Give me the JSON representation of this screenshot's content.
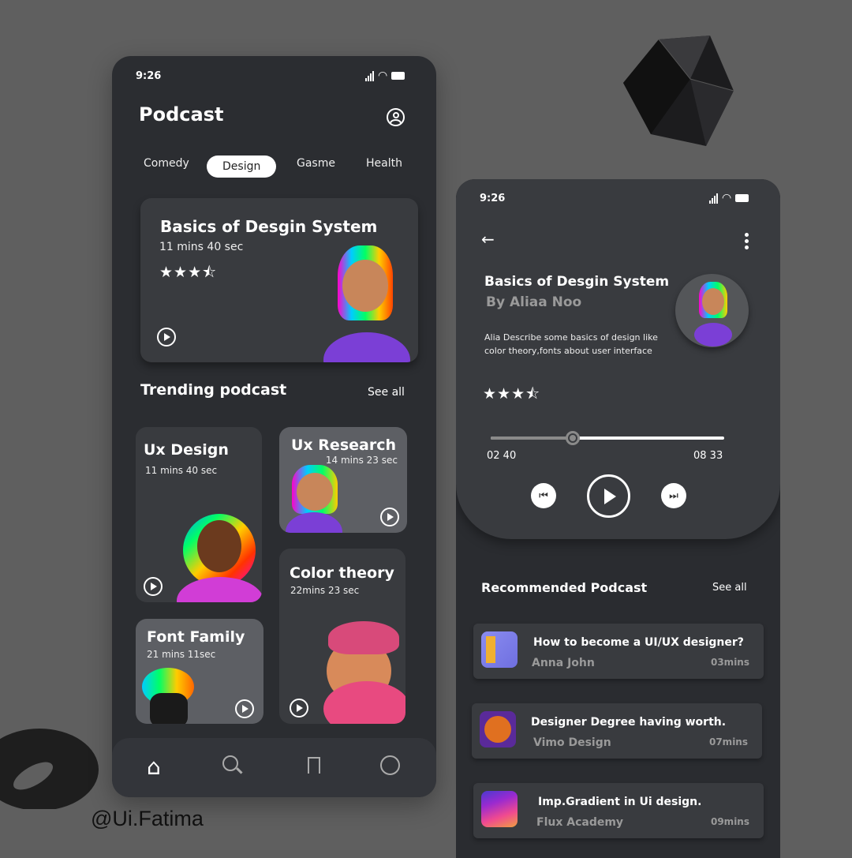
{
  "left_screen": {
    "status_time": "9:26",
    "title": "Podcast",
    "tabs": [
      {
        "label": "Comedy"
      },
      {
        "label": "Design",
        "active": true
      },
      {
        "label": "Gasme"
      },
      {
        "label": "Health"
      }
    ],
    "featured": {
      "title": "Basics of Desgin System",
      "duration": "11 mins 40 sec",
      "rating": 3.5,
      "stars": "★★★⯪"
    },
    "trending": {
      "title": "Trending podcast",
      "see_all": "See all",
      "items": [
        {
          "title": "Ux Design",
          "duration": "11 mins 40 sec"
        },
        {
          "title": "Ux Research",
          "duration": "14 mins 23 sec"
        },
        {
          "title": "Color theory",
          "duration": "22mins 23 sec"
        },
        {
          "title": "Font Family",
          "duration": "21 mins 11sec"
        }
      ]
    },
    "nav": [
      "home-icon",
      "search-icon",
      "bookmark-icon",
      "profile-icon"
    ]
  },
  "right_screen": {
    "status_time": "9:26",
    "title": "Basics of Desgin System",
    "author": "By  Aliaa Noo",
    "description_line1": "Alia Describe some basics of design like",
    "description_line2": "color theory,fonts  about user interface",
    "rating": 3.5,
    "stars": "★★★⯪",
    "progress_percent": 35,
    "elapsed": "02 40",
    "total": "08 33",
    "recommended": {
      "title": "Recommended Podcast",
      "see_all": "See all",
      "items": [
        {
          "title": "How to become a UI/UX designer?",
          "author": "Anna John",
          "duration": "03mins"
        },
        {
          "title": "Designer  Degree having worth.",
          "author": "Vimo Design",
          "duration": "07mins"
        },
        {
          "title": "Imp.Gradient in Ui design.",
          "author": "Flux Academy",
          "duration": "09mins"
        }
      ]
    }
  },
  "watermark": "@Ui.Fatima",
  "colors": {
    "background": "#5f5f5f",
    "screen": "#2b2d31",
    "card": "#393b3f",
    "card_light": "#5d5f64",
    "text": "#ffffff",
    "muted": "#9a9a9a"
  }
}
